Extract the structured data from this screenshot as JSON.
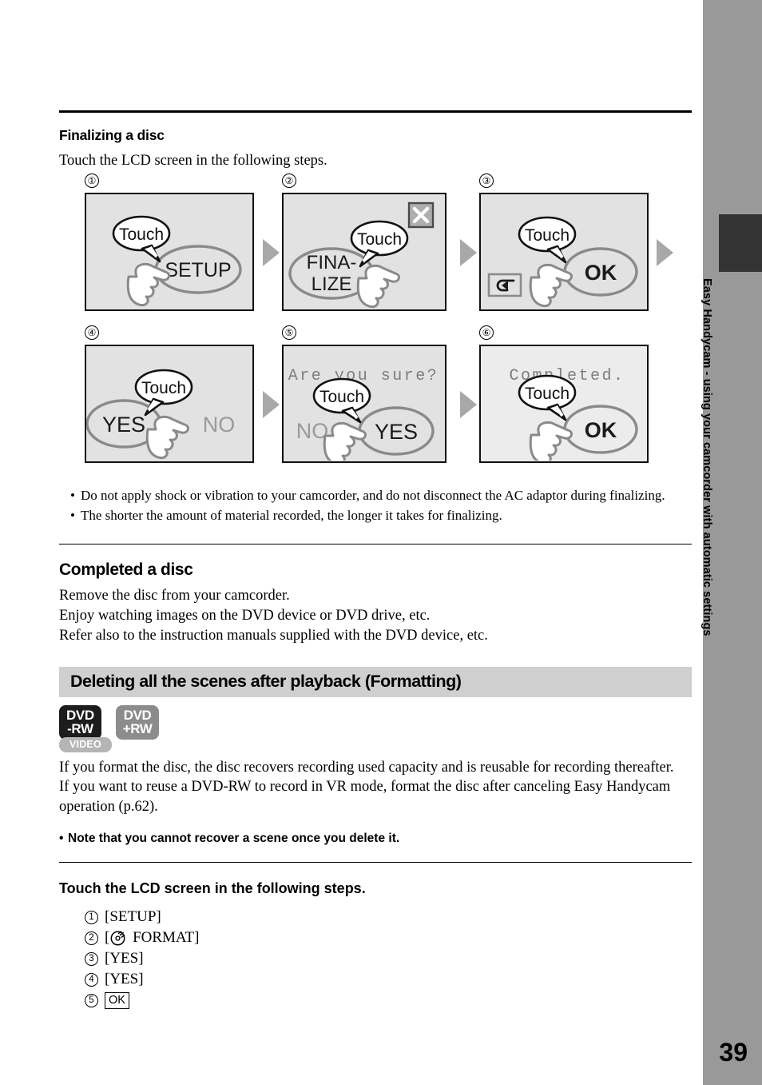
{
  "page": {
    "number": "39",
    "side_tab_label": "Easy Handycam - using your camcorder with automatic settings"
  },
  "section_finalizing": {
    "heading": "Finalizing a disc",
    "intro": "Touch the LCD screen in the following steps.",
    "steps": [
      {
        "num": "①",
        "callout": "Touch",
        "button_label": "SETUP",
        "button_style": "ellipse-selected",
        "hand": true,
        "hand_side": "left",
        "message": "",
        "secondary_label": "",
        "icons": []
      },
      {
        "num": "②",
        "callout": "Touch",
        "button_label": "FINA-\nLIZE",
        "button_style": "ellipse-selected",
        "hand": true,
        "hand_side": "right",
        "message": "",
        "secondary_label": "",
        "icons": [
          "close-icon"
        ]
      },
      {
        "num": "③",
        "callout": "Touch",
        "button_label": "OK",
        "button_style": "ellipse-selected",
        "hand": true,
        "hand_side": "left",
        "message": "",
        "secondary_label": "",
        "icons": [
          "return-icon"
        ]
      },
      {
        "num": "④",
        "callout": "Touch",
        "button_label": "YES",
        "button_style": "ellipse-selected",
        "hand": true,
        "hand_side": "left",
        "message": "",
        "secondary_label": "NO",
        "icons": []
      },
      {
        "num": "⑤",
        "callout": "Touch",
        "button_label": "YES",
        "button_style": "ellipse-selected",
        "hand": true,
        "hand_side": "right",
        "message": "Are you sure?",
        "secondary_label": "NO",
        "icons": []
      },
      {
        "num": "⑥",
        "callout": "Touch",
        "button_label": "OK",
        "button_style": "ellipse-selected",
        "hand": true,
        "hand_side": "left",
        "message": "Completed.",
        "secondary_label": "",
        "icons": []
      }
    ],
    "notes": [
      "Do not apply shock or vibration to your camcorder, and do not disconnect the AC adaptor during finalizing.",
      "The shorter the amount of material recorded, the longer it takes for finalizing."
    ]
  },
  "section_completed": {
    "heading": "Completed a disc",
    "lines": [
      "Remove the disc from your camcorder.",
      "Enjoy watching images on the DVD device or DVD drive, etc.",
      "Refer also to the instruction manuals supplied with the DVD device, etc."
    ]
  },
  "section_formatting": {
    "banner_title": "Deleting all the scenes after playback (Formatting)",
    "badges": [
      {
        "line1": "DVD",
        "line2": "-RW",
        "style": "dark"
      },
      {
        "line1": "DVD",
        "line2": "+RW",
        "style": "grey"
      }
    ],
    "video_badge": "VIDEO",
    "paragraphs": [
      "If you format the disc, the disc recovers recording used capacity and is reusable for recording thereafter.",
      "If you want to reuse a DVD-RW to record in VR mode, format the disc after canceling Easy Handycam operation (p.62)."
    ],
    "note": "Note that you cannot recover a scene once you delete it.",
    "steps_heading": "Touch the LCD screen in the following steps.",
    "steps": [
      {
        "num": "1",
        "text": "[SETUP]",
        "icon": "",
        "boxed": false
      },
      {
        "num": "2",
        "text": " FORMAT]",
        "prefix": "[",
        "icon": "disc-icon",
        "boxed": false
      },
      {
        "num": "3",
        "text": "[YES]",
        "icon": "",
        "boxed": false
      },
      {
        "num": "4",
        "text": "[YES]",
        "icon": "",
        "boxed": false
      },
      {
        "num": "5",
        "text": "OK",
        "icon": "",
        "boxed": true
      }
    ]
  },
  "colors": {
    "lcd_bg": "#e2e2e2",
    "lcd_bg_light": "#ececec",
    "banner_bg": "#cfcfcf",
    "side_tab_bg": "#999999",
    "side_tab_dark": "#333333",
    "arrow_grey": "#a8a8a8",
    "badge_dark": "#1c1c1c",
    "badge_grey": "#8c8c8c",
    "video_badge": "#b5b5b5",
    "outline_grey": "#8a8a8a"
  },
  "bullet_glyph": "•"
}
